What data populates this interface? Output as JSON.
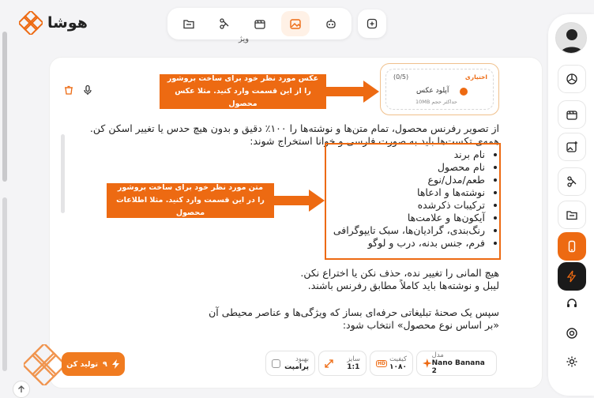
{
  "brand": {
    "name": "هوشا"
  },
  "header": {
    "partial_title": "ویژ"
  },
  "upload": {
    "badge": "اختیاری",
    "count": "(0/5)",
    "label": "آپلود عکس",
    "hint": "حداکثر حجم 10MB"
  },
  "callouts": {
    "image": [
      "عکس مورد نظر خود برای ساخت بروشور",
      "را از این قسمت وارد کنید. مثلا عکس محصول"
    ],
    "text": [
      "متن مورد نظر خود برای ساخت بروشور",
      "را در این قسمت وارد کنید. مثلا اطلاعات محصول"
    ]
  },
  "prompt": {
    "intro": [
      "از تصویر رفرنس محصول، تمام متن‌ها و نوشته‌ها را ۱۰۰٪ دقیق و بدون هیچ حدس یا تغییر اسکن کن.",
      "همه‌ی تکست‌ها باید به صورت فارسی و خوانا استخراج شوند:"
    ],
    "items": [
      "نام برند",
      "نام محصول",
      "طعم/مدل/نوع",
      "نوشته‌ها و ادعاها",
      "ترکیبات ذکرشده",
      "آیکون‌ها و علامت‌ها",
      "رنگ‌بندی، گرادیان‌ها، سبک تایپوگرافی",
      "فرم، جنس بدنه، درب و لوگو"
    ],
    "outro": [
      "هیچ المانی را تغییر نده، حذف نکن یا اختراع نکن.",
      "لیبل و نوشته‌ها باید کاملاً مطابق رفرنس باشند."
    ],
    "final": [
      "سپس یک صحنهٔ تبلیغاتی حرفه‌ای بساز که ویژگی‌ها و عناصر محیطی آن",
      "«بر اساس نوع محصول» انتخاب شود:"
    ]
  },
  "settings": {
    "model": {
      "label": "مدل",
      "value": "Nano Banana 2"
    },
    "quality": {
      "label": "کیفیت",
      "value": "۱۰۸۰",
      "icon_text": "HD"
    },
    "size": {
      "label": "سایز",
      "value": "1:1"
    },
    "enhance": {
      "label": "بهبود",
      "value": "پرامپت"
    }
  },
  "generate": {
    "label": "تولید کن",
    "cost": "۹"
  },
  "colors": {
    "accent": "#ed6a12",
    "accent_light": "#fff1e6",
    "dark_item": "#1a1a1a"
  },
  "icons": {
    "tabs": [
      "folder-icon",
      "video-edit-icon",
      "film-icon",
      "image-edit-icon",
      "robot-icon"
    ],
    "sidebar": [
      "openai-icon",
      "film-icon",
      "image-add-icon",
      "video-edit-icon",
      "folder-icon",
      "phone-icon",
      "bolt-icon",
      "headset-icon",
      "lifebuoy-icon",
      "gear-icon"
    ]
  }
}
